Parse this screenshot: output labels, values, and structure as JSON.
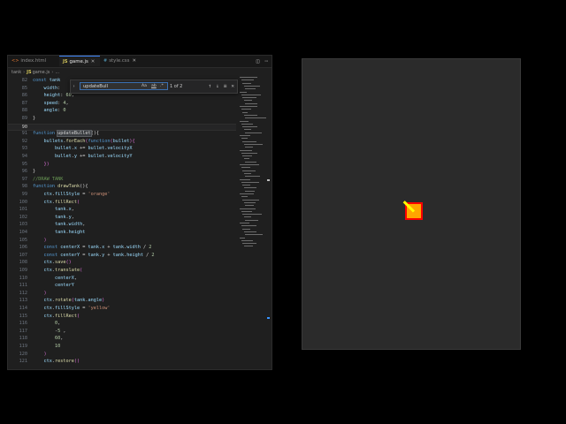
{
  "tabs": [
    {
      "icon": "<>",
      "label": "index.html",
      "active": false
    },
    {
      "icon": "JS",
      "label": "game.js",
      "active": true
    },
    {
      "icon": "#",
      "label": "style.css",
      "active": false
    }
  ],
  "breadcrumb": {
    "folder": "tank",
    "file": "game.js",
    "more": "..."
  },
  "find": {
    "value": "updateBull",
    "match_case": "Aa",
    "whole_word": "ab",
    "regex": ".*",
    "count": "1 of 2"
  },
  "code_lines": [
    {
      "num": "82",
      "segs": [
        [
          "kw",
          "const "
        ],
        [
          "var",
          "tank"
        ]
      ]
    },
    {
      "num": "85",
      "segs": [
        [
          "pn",
          "    "
        ],
        [
          "var",
          "width"
        ],
        [
          "pn",
          ":"
        ]
      ]
    },
    {
      "num": "86",
      "segs": [
        [
          "pn",
          "    "
        ],
        [
          "var",
          "height"
        ],
        [
          "pn",
          ": "
        ],
        [
          "num",
          "60"
        ],
        [
          "pn",
          ","
        ]
      ]
    },
    {
      "num": "87",
      "segs": [
        [
          "pn",
          "    "
        ],
        [
          "var",
          "speed"
        ],
        [
          "pn",
          ": "
        ],
        [
          "num",
          "4"
        ],
        [
          "pn",
          ","
        ]
      ]
    },
    {
      "num": "88",
      "segs": [
        [
          "pn",
          "    "
        ],
        [
          "var",
          "angle"
        ],
        [
          "pn",
          ": "
        ],
        [
          "num",
          "0"
        ]
      ]
    },
    {
      "num": "89",
      "segs": [
        [
          "pn",
          "}"
        ]
      ]
    },
    {
      "num": "90",
      "segs": [],
      "current": true
    },
    {
      "num": "91",
      "segs": [
        [
          "kw",
          "function "
        ],
        [
          "hl",
          "updateBullet"
        ],
        [
          "pn",
          "(){"
        ]
      ]
    },
    {
      "num": "92",
      "segs": [
        [
          "pn",
          "    "
        ],
        [
          "var",
          "bullets"
        ],
        [
          "pn",
          "."
        ],
        [
          "fn",
          "forEach"
        ],
        [
          "br",
          "("
        ],
        [
          "kw",
          "function"
        ],
        [
          "br",
          "("
        ],
        [
          "var",
          "bullet"
        ],
        [
          "br",
          ")"
        ],
        [
          "br",
          "{"
        ]
      ]
    },
    {
      "num": "93",
      "segs": [
        [
          "pn",
          "        "
        ],
        [
          "var",
          "bullet"
        ],
        [
          "pn",
          "."
        ],
        [
          "var",
          "x"
        ],
        [
          "pn",
          " += "
        ],
        [
          "var",
          "bullet"
        ],
        [
          "pn",
          "."
        ],
        [
          "var",
          "velocityX"
        ]
      ]
    },
    {
      "num": "94",
      "segs": [
        [
          "pn",
          "        "
        ],
        [
          "var",
          "bullet"
        ],
        [
          "pn",
          "."
        ],
        [
          "var",
          "y"
        ],
        [
          "pn",
          " += "
        ],
        [
          "var",
          "bullet"
        ],
        [
          "pn",
          "."
        ],
        [
          "var",
          "velocityY"
        ]
      ]
    },
    {
      "num": "95",
      "segs": [
        [
          "pn",
          "    "
        ],
        [
          "br",
          "})"
        ]
      ]
    },
    {
      "num": "96",
      "segs": [
        [
          "pn",
          "}"
        ]
      ]
    },
    {
      "num": "97",
      "segs": [
        [
          "cm",
          "//DRAW TANK"
        ]
      ]
    },
    {
      "num": "98",
      "segs": [
        [
          "kw",
          "function "
        ],
        [
          "fn",
          "drawTank"
        ],
        [
          "pn",
          "(){"
        ]
      ]
    },
    {
      "num": "99",
      "segs": [
        [
          "pn",
          "    "
        ],
        [
          "var",
          "ctx"
        ],
        [
          "pn",
          "."
        ],
        [
          "var",
          "fillStyle"
        ],
        [
          "pn",
          " = "
        ],
        [
          "str",
          "'orange'"
        ]
      ]
    },
    {
      "num": "100",
      "segs": [
        [
          "pn",
          "    "
        ],
        [
          "var",
          "ctx"
        ],
        [
          "pn",
          "."
        ],
        [
          "fn",
          "fillRect"
        ],
        [
          "br",
          "("
        ]
      ]
    },
    {
      "num": "101",
      "segs": [
        [
          "pn",
          "        "
        ],
        [
          "var",
          "tank"
        ],
        [
          "pn",
          "."
        ],
        [
          "var",
          "x"
        ],
        [
          "pn",
          ","
        ]
      ]
    },
    {
      "num": "102",
      "segs": [
        [
          "pn",
          "        "
        ],
        [
          "var",
          "tank"
        ],
        [
          "pn",
          "."
        ],
        [
          "var",
          "y"
        ],
        [
          "pn",
          ","
        ]
      ]
    },
    {
      "num": "103",
      "segs": [
        [
          "pn",
          "        "
        ],
        [
          "var",
          "tank"
        ],
        [
          "pn",
          "."
        ],
        [
          "var",
          "width"
        ],
        [
          "pn",
          ","
        ]
      ]
    },
    {
      "num": "104",
      "segs": [
        [
          "pn",
          "        "
        ],
        [
          "var",
          "tank"
        ],
        [
          "pn",
          "."
        ],
        [
          "var",
          "height"
        ]
      ]
    },
    {
      "num": "105",
      "segs": [
        [
          "pn",
          "    "
        ],
        [
          "br",
          ")"
        ]
      ]
    },
    {
      "num": "106",
      "segs": [
        [
          "pn",
          "    "
        ],
        [
          "kw",
          "const "
        ],
        [
          "var",
          "centerX"
        ],
        [
          "pn",
          " = "
        ],
        [
          "var",
          "tank"
        ],
        [
          "pn",
          "."
        ],
        [
          "var",
          "x"
        ],
        [
          "pn",
          " + "
        ],
        [
          "var",
          "tank"
        ],
        [
          "pn",
          "."
        ],
        [
          "var",
          "width"
        ],
        [
          "pn",
          " / "
        ],
        [
          "num",
          "2"
        ]
      ]
    },
    {
      "num": "107",
      "segs": [
        [
          "pn",
          "    "
        ],
        [
          "kw",
          "const "
        ],
        [
          "var",
          "centerY"
        ],
        [
          "pn",
          " = "
        ],
        [
          "var",
          "tank"
        ],
        [
          "pn",
          "."
        ],
        [
          "var",
          "y"
        ],
        [
          "pn",
          " + "
        ],
        [
          "var",
          "tank"
        ],
        [
          "pn",
          "."
        ],
        [
          "var",
          "height"
        ],
        [
          "pn",
          " / "
        ],
        [
          "num",
          "2"
        ]
      ]
    },
    {
      "num": "108",
      "segs": [
        [
          "pn",
          "    "
        ],
        [
          "var",
          "ctx"
        ],
        [
          "pn",
          "."
        ],
        [
          "fn",
          "save"
        ],
        [
          "br",
          "()"
        ]
      ]
    },
    {
      "num": "109",
      "segs": [
        [
          "pn",
          "    "
        ],
        [
          "var",
          "ctx"
        ],
        [
          "pn",
          "."
        ],
        [
          "fn",
          "translate"
        ],
        [
          "br",
          "("
        ]
      ]
    },
    {
      "num": "110",
      "segs": [
        [
          "pn",
          "        "
        ],
        [
          "var",
          "centerX"
        ],
        [
          "pn",
          ","
        ]
      ]
    },
    {
      "num": "111",
      "segs": [
        [
          "pn",
          "        "
        ],
        [
          "var",
          "centerY"
        ]
      ]
    },
    {
      "num": "112",
      "segs": [
        [
          "pn",
          "    "
        ],
        [
          "br",
          ")"
        ]
      ]
    },
    {
      "num": "113",
      "segs": [
        [
          "pn",
          "    "
        ],
        [
          "var",
          "ctx"
        ],
        [
          "pn",
          "."
        ],
        [
          "fn",
          "rotate"
        ],
        [
          "br",
          "("
        ],
        [
          "var",
          "tank"
        ],
        [
          "pn",
          "."
        ],
        [
          "var",
          "angle"
        ],
        [
          "br",
          ")"
        ]
      ]
    },
    {
      "num": "114",
      "segs": [
        [
          "pn",
          "    "
        ],
        [
          "var",
          "ctx"
        ],
        [
          "pn",
          "."
        ],
        [
          "var",
          "fillStyle"
        ],
        [
          "pn",
          " = "
        ],
        [
          "str",
          "'yellow'"
        ]
      ]
    },
    {
      "num": "115",
      "segs": [
        [
          "pn",
          "    "
        ],
        [
          "var",
          "ctx"
        ],
        [
          "pn",
          "."
        ],
        [
          "fn",
          "fillRect"
        ],
        [
          "br",
          "("
        ]
      ]
    },
    {
      "num": "116",
      "segs": [
        [
          "pn",
          "        "
        ],
        [
          "num",
          "0"
        ],
        [
          "pn",
          ","
        ]
      ]
    },
    {
      "num": "117",
      "segs": [
        [
          "pn",
          "        "
        ],
        [
          "pn",
          "-"
        ],
        [
          "num",
          "5"
        ],
        [
          "pn",
          " ,"
        ]
      ]
    },
    {
      "num": "118",
      "segs": [
        [
          "pn",
          "        "
        ],
        [
          "num",
          "60"
        ],
        [
          "pn",
          ","
        ]
      ]
    },
    {
      "num": "119",
      "segs": [
        [
          "pn",
          "        "
        ],
        [
          "num",
          "10"
        ]
      ]
    },
    {
      "num": "120",
      "segs": [
        [
          "pn",
          "    "
        ],
        [
          "br",
          ")"
        ]
      ]
    },
    {
      "num": "121",
      "segs": [
        [
          "pn",
          "    "
        ],
        [
          "var",
          "ctx"
        ],
        [
          "pn",
          "."
        ],
        [
          "fn",
          "restore"
        ],
        [
          "br",
          "()"
        ]
      ]
    }
  ],
  "game": {
    "background": "#2b2b2b",
    "tank_color": "#ffa500",
    "tank_border_color": "#ff0000",
    "barrel_color": "#ffff00",
    "barrel_angle_deg": -135
  }
}
